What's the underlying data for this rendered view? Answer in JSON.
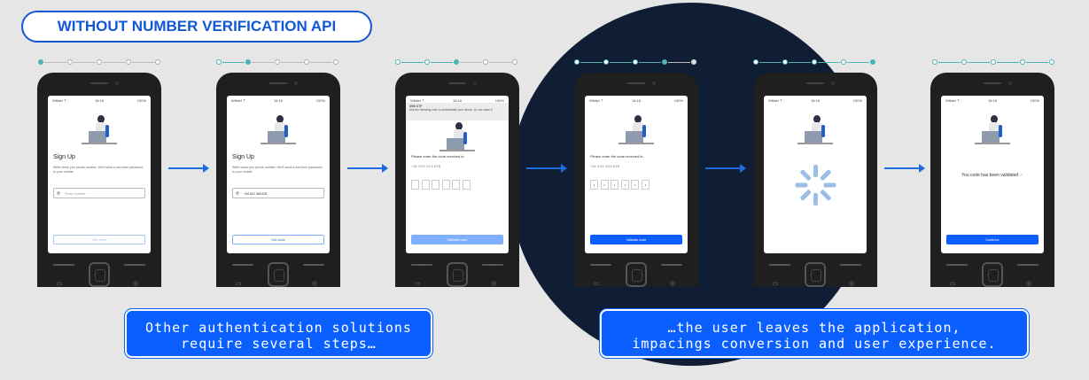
{
  "header": {
    "title": "WITHOUT NUMBER VERIFICATION API"
  },
  "status_bar": {
    "carrier": "Wikitel ⇡",
    "time": "16:16",
    "battery": "100%"
  },
  "phones": [
    {
      "title": "Sign Up",
      "desc": "Write down you phone number. We'll send a one-time password to your mobile",
      "field": "Phone Number",
      "button": "Get code"
    },
    {
      "title": "Sign Up",
      "desc": "Write down you phone number. We'll send a one-time password to your mobile",
      "field": "+34 612 345 678",
      "button": "Get code"
    },
    {
      "sms_title": "SMS OTP",
      "sms_body": "Use the following code to authenticate your device. Do not share it",
      "prompt": "Please enter the code received in:",
      "number": "+34 XXX XXX 678",
      "button": "Validate code"
    },
    {
      "prompt": "Please enter the code received in:",
      "number": "+34 XXX XXX 678",
      "code": [
        "•",
        "•",
        "•",
        "•",
        "•",
        "•"
      ],
      "button": "Validate code"
    },
    {},
    {
      "message": "You code has been validated",
      "check": "✓",
      "button": "Continue"
    }
  ],
  "callouts": {
    "left": {
      "line1": "Other authentication solutions",
      "line2": "require several steps…"
    },
    "right": {
      "line1": "…the user leaves the application,",
      "line2": "impacings conversion and user experience."
    }
  }
}
